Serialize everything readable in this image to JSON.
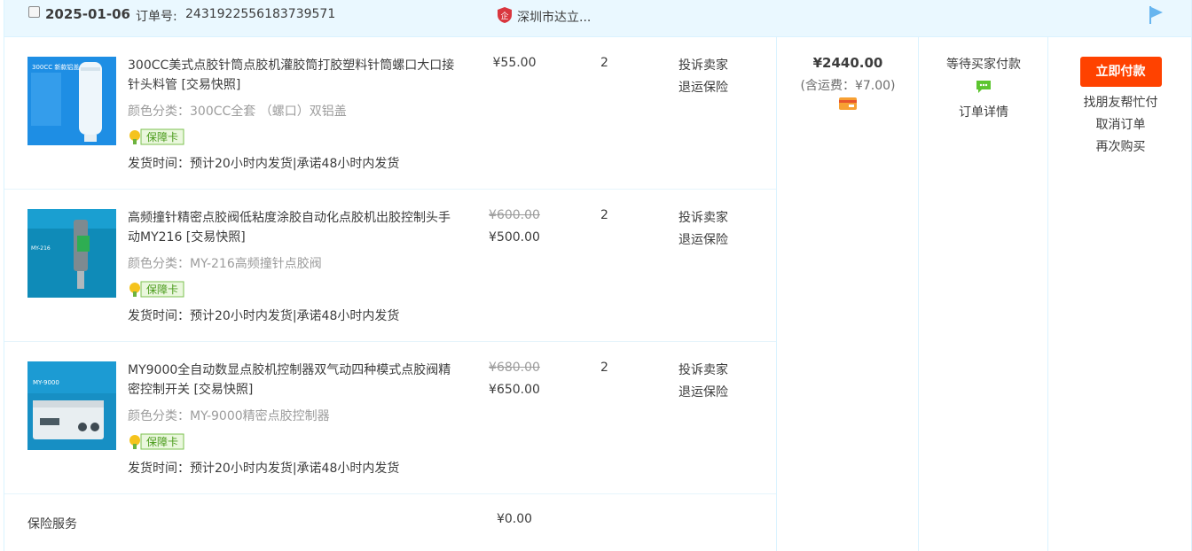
{
  "header": {
    "date": "2025-01-06",
    "order_no_label": "订单号:",
    "order_no": "2431922556183739571",
    "shop_name": "深圳市达立...",
    "shield_text": "企"
  },
  "items": [
    {
      "title": "300CC美式点胶针筒点胶机灌胶筒打胶塑料针筒螺口大口接针头料管 [交易快照]",
      "spec": "颜色分类：300CC全套 （螺口）双铝盖",
      "card": "保障卡",
      "ship": "发货时间：预计20小时内发货|承诺48小时内发货",
      "price_old": "",
      "price": "¥55.00",
      "qty": "2",
      "link1": "投诉卖家",
      "link2": "退运保险",
      "thumb_text": "300CC 新款铝盖"
    },
    {
      "title": "高频撞针精密点胶阀低粘度涂胶自动化点胶机出胶控制头手动MY216 [交易快照]",
      "spec": "颜色分类：MY-216高频撞针点胶阀",
      "card": "保障卡",
      "ship": "发货时间：预计20小时内发货|承诺48小时内发货",
      "price_old": "¥600.00",
      "price": "¥500.00",
      "qty": "2",
      "link1": "投诉卖家",
      "link2": "退运保险",
      "thumb_text": "MY-216"
    },
    {
      "title": "MY9000全自动数显点胶机控制器双气动四种模式点胶阀精密控制开关 [交易快照]",
      "spec": "颜色分类：MY-9000精密点胶控制器",
      "card": "保障卡",
      "ship": "发货时间：预计20小时内发货|承诺48小时内发货",
      "price_old": "¥680.00",
      "price": "¥650.00",
      "qty": "2",
      "link1": "投诉卖家",
      "link2": "退运保险",
      "thumb_text": "MY-9000"
    }
  ],
  "insurance": {
    "label": "保险服务",
    "price": "¥0.00"
  },
  "total": {
    "amount": "¥2440.00",
    "fee": "(含运费：¥7.00)"
  },
  "status": {
    "text": "等待买家付款",
    "detail": "订单详情"
  },
  "ops": {
    "pay": "立即付款",
    "friend": "找朋友帮忙付",
    "cancel": "取消订单",
    "rebuy": "再次购买"
  },
  "colors": {
    "accent": "#ff4200",
    "header_bg": "#eaf8ff",
    "border": "#daf3ff"
  }
}
